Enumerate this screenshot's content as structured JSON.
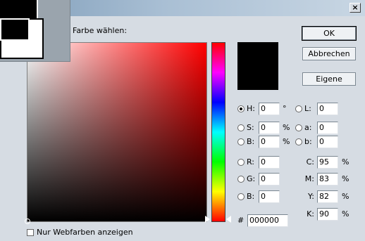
{
  "dialog": {
    "prompt": "Farbe wählen:",
    "close_glyph": "×"
  },
  "buttons": {
    "ok": "OK",
    "cancel": "Abbrechen",
    "custom": "Eigene"
  },
  "hsb": {
    "h": {
      "label": "H:",
      "value": "0",
      "unit": "°"
    },
    "s": {
      "label": "S:",
      "value": "0",
      "unit": "%"
    },
    "b": {
      "label": "B:",
      "value": "0",
      "unit": "%"
    }
  },
  "lab": {
    "l": {
      "label": "L:",
      "value": "0"
    },
    "a": {
      "label": "a:",
      "value": "0"
    },
    "b": {
      "label": "b:",
      "value": "0"
    }
  },
  "rgb": {
    "r": {
      "label": "R:",
      "value": "0"
    },
    "g": {
      "label": "G:",
      "value": "0"
    },
    "b": {
      "label": "B:",
      "value": "0"
    }
  },
  "cmyk": {
    "c": {
      "label": "C:",
      "value": "95",
      "unit": "%"
    },
    "m": {
      "label": "M:",
      "value": "83",
      "unit": "%"
    },
    "y": {
      "label": "Y:",
      "value": "82",
      "unit": "%"
    },
    "k": {
      "label": "K:",
      "value": "90",
      "unit": "%"
    }
  },
  "hex": {
    "symbol": "#",
    "value": "000000"
  },
  "web_only": {
    "label": "Nur Webfarben anzeigen",
    "checked": false
  },
  "colors": {
    "current": "#000000",
    "hue_base": "#ff0000"
  },
  "selected_mode": "H"
}
